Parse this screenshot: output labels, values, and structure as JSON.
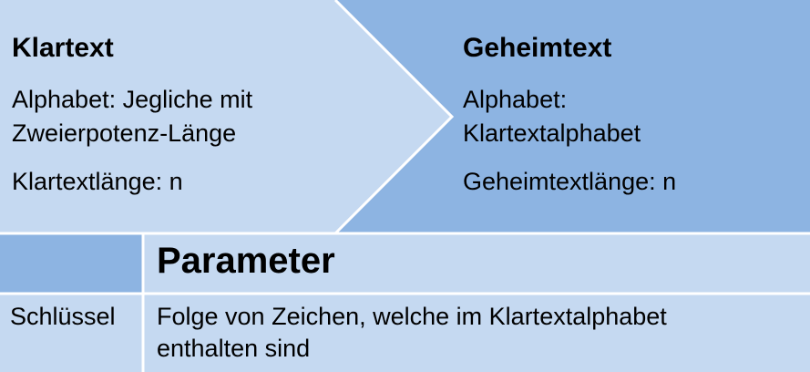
{
  "colors": {
    "light_blue": "#c5d9f1",
    "mid_blue": "#8db4e2",
    "divider": "#ffffff"
  },
  "plaintext": {
    "title": "Klartext",
    "alphabet_line1": "Alphabet: Jegliche mit",
    "alphabet_line2": "Zweierpotenz-Länge",
    "length": "Klartextlänge: n"
  },
  "ciphertext": {
    "title": "Geheimtext",
    "alphabet_line1": "Alphabet:",
    "alphabet_line2": "Klartextalphabet",
    "length": "Geheimtextlänge: n"
  },
  "parameters": {
    "header": "Parameter",
    "rows": [
      {
        "name": "Schlüssel",
        "description_line1": "Folge von Zeichen, welche im Klartextalphabet",
        "description_line2": "enthalten sind"
      }
    ]
  }
}
